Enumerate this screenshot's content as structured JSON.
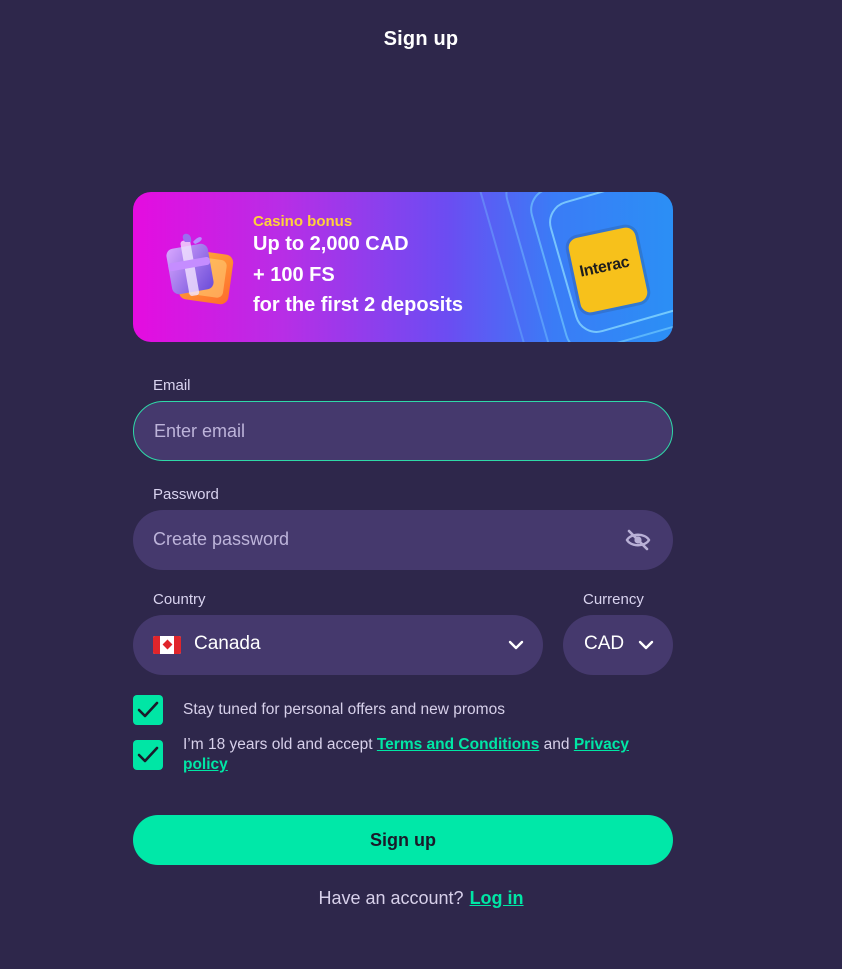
{
  "page": {
    "title": "Sign up"
  },
  "banner": {
    "label": "Casino bonus",
    "line1": "Up to 2,000 CAD",
    "line2": "+ 100 FS",
    "line3": "for the first 2 deposits",
    "payment_logo_text": "Interac"
  },
  "email": {
    "label": "Email",
    "placeholder": "Enter email",
    "value": ""
  },
  "password": {
    "label": "Password",
    "placeholder": "Create password",
    "value": "",
    "toggle_icon": "eye-off-icon"
  },
  "country": {
    "label": "Country",
    "value": "Canada",
    "flag_icon": "canada-flag-icon"
  },
  "currency": {
    "label": "Currency",
    "value": "CAD"
  },
  "checkboxes": {
    "promos": {
      "checked": true,
      "text": "Stay tuned for personal offers and new promos"
    },
    "terms": {
      "checked": true,
      "prefix": "I’m 18 years old and accept ",
      "terms_link": "Terms and Conditions",
      "middle": " and ",
      "privacy_link": "Privacy policy"
    }
  },
  "submit": {
    "label": "Sign up"
  },
  "login": {
    "prompt": "Have an account?",
    "link": "Log in"
  },
  "colors": {
    "background": "#2e274b",
    "field": "#45396d",
    "accent": "#00e6a5",
    "bonus_label": "#ffd23a"
  }
}
